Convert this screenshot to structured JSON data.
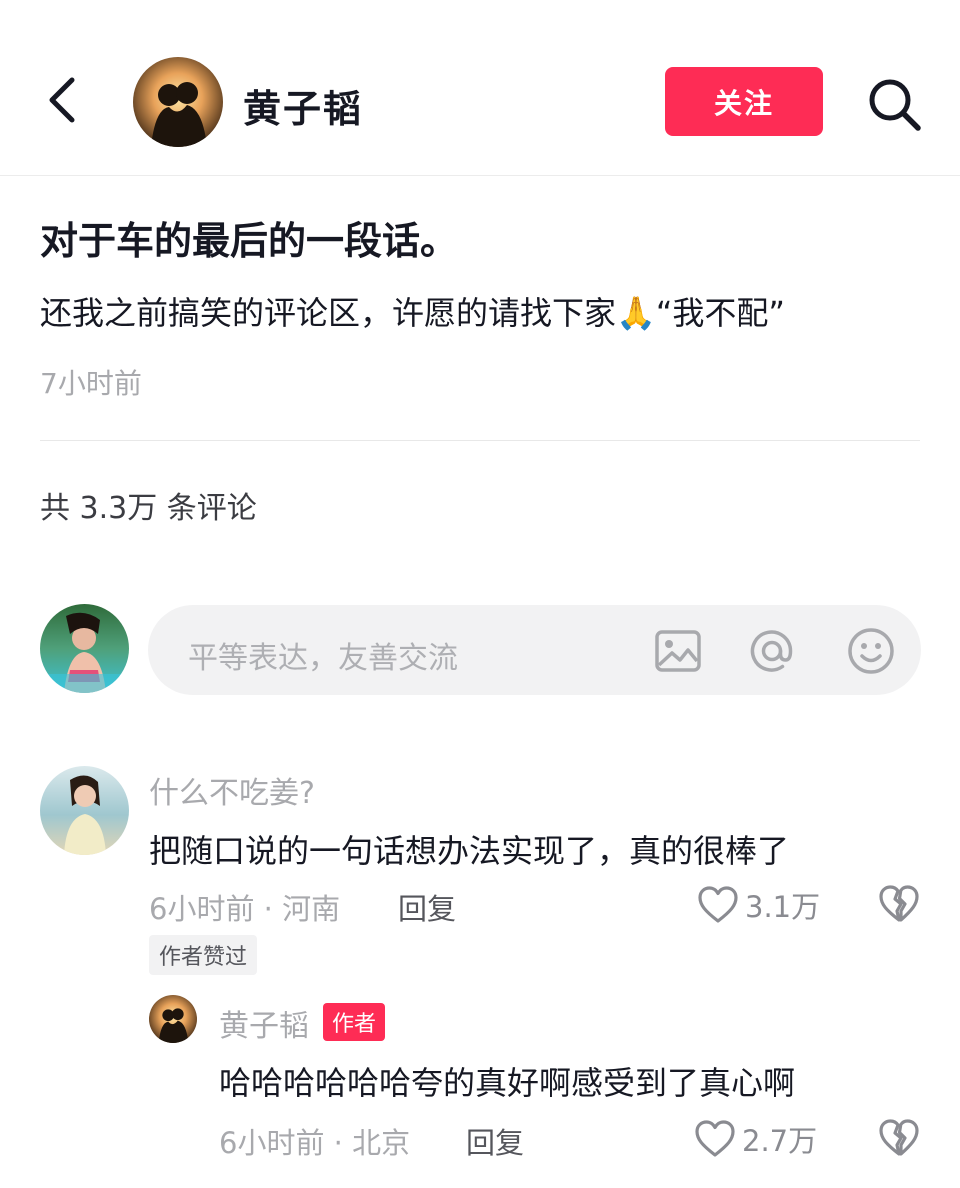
{
  "header": {
    "author_name": "黄子韬",
    "follow_label": "关注"
  },
  "post": {
    "title": "对于车的最后的一段话。",
    "body": "还我之前搞笑的评论区，许愿的请找下家🙏“我不配”",
    "time": "7小时前"
  },
  "comments_summary": {
    "count_text": "共 3.3万 条评论"
  },
  "comment_input": {
    "placeholder": "平等表达，友善交流"
  },
  "comments": [
    {
      "user": "什么不吃姜?",
      "text": "把随口说的一句话想办法实现了，真的很棒了",
      "meta": "6小时前 · 河南",
      "reply_label": "回复",
      "likes": "3.1万",
      "liked_tag": "作者赞过",
      "replies": [
        {
          "user": "黄子韬",
          "author_tag": "作者",
          "text": "哈哈哈哈哈哈夸的真好啊感受到了真心啊",
          "meta": "6小时前 · 北京",
          "reply_label": "回复",
          "likes": "2.7万"
        }
      ]
    }
  ],
  "colors": {
    "accent": "#fe2c55",
    "text_primary": "#161823",
    "text_secondary": "#a8a9ad",
    "input_bg": "#f2f2f3"
  }
}
